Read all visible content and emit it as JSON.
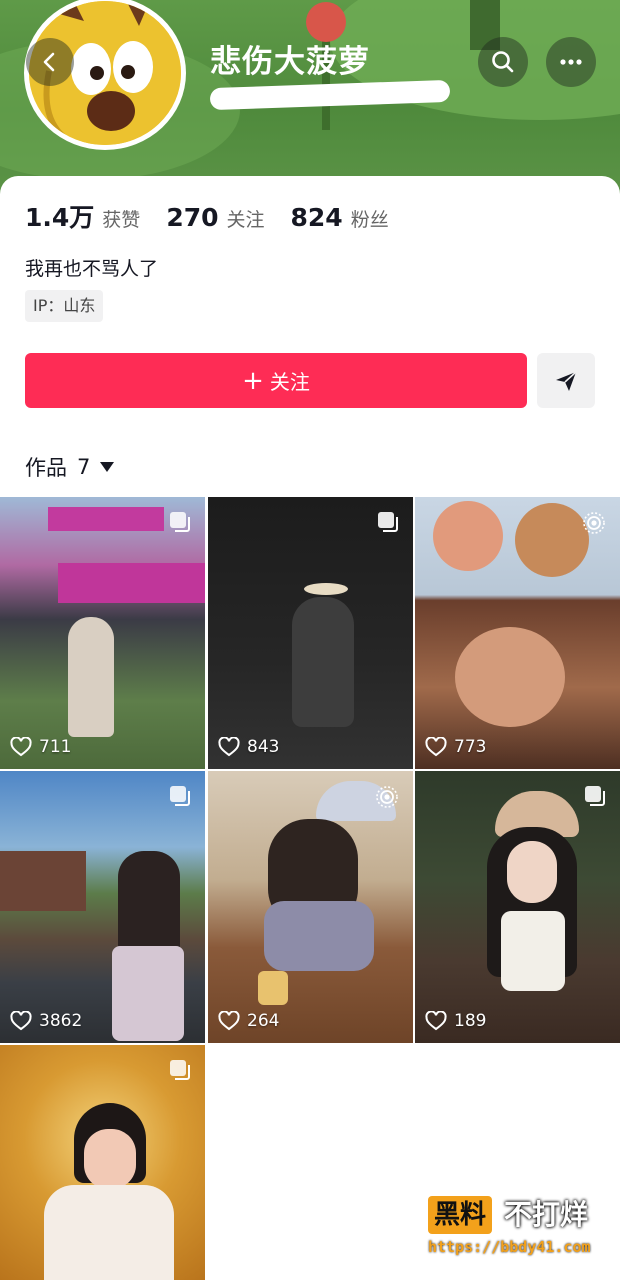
{
  "profile": {
    "username": "悲伤大菠萝",
    "bio": "我再也不骂人了",
    "ip_location": "IP：山东"
  },
  "stats": [
    {
      "value": "1.4万",
      "label": "获赞"
    },
    {
      "value": "270",
      "label": "关注"
    },
    {
      "value": "824",
      "label": "粉丝"
    }
  ],
  "actions": {
    "follow_plus": "+",
    "follow_label": "关注"
  },
  "works_tab": {
    "label": "作品",
    "count": "7"
  },
  "videos": [
    {
      "likes": "711"
    },
    {
      "likes": "843"
    },
    {
      "likes": "773"
    },
    {
      "likes": "3862"
    },
    {
      "likes": "264"
    },
    {
      "likes": "189"
    },
    {
      "likes": ""
    }
  ],
  "watermark": {
    "badge": "黑料",
    "side": "不打烊",
    "url": "https://bbdy41.com"
  },
  "colors": {
    "accent": "#fe2c55",
    "header_green": "#5f9a48"
  }
}
